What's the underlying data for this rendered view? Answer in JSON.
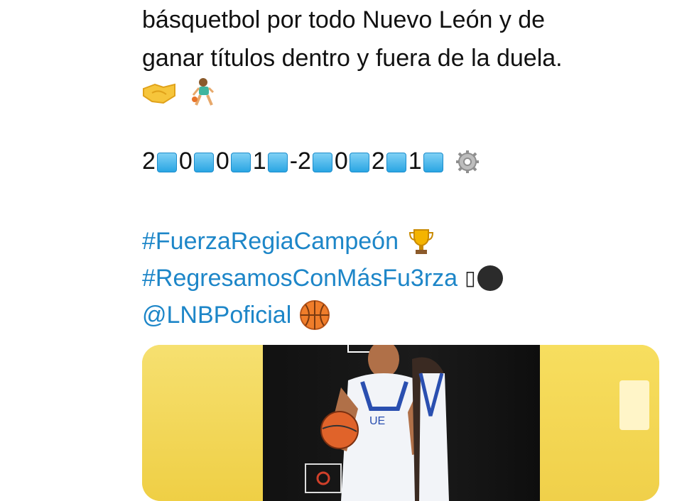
{
  "tweet": {
    "line1": "básquetbol por todo Nuevo León y de",
    "line2": "ganar títulos dentro y fuera de la duela.",
    "emojis": [
      "handshake-emoji",
      "person-dribbling-emoji"
    ],
    "counter_digits": [
      "2",
      "0",
      "0",
      "1",
      "-2",
      "0",
      "2",
      "1"
    ],
    "counter_end_icon": "gear-icon",
    "hashtag1": "#FuerzaRegiaCampeón",
    "hashtag2": "#RegresamosConMásFu3rza",
    "hashtag2_glyph": "▯",
    "mention": "@LNBPoficial",
    "colors": {
      "link": "#1d86c8",
      "text": "#111111",
      "keycap": "#2aa6e3",
      "media_yellow": "#f4d95a"
    }
  },
  "media": {
    "icon": "video-thumbnail"
  }
}
